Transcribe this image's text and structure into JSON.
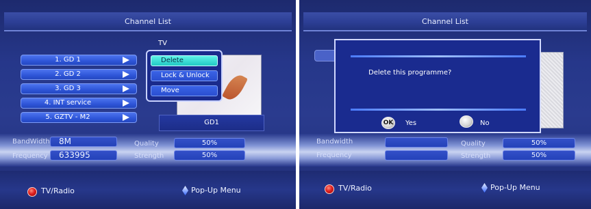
{
  "left": {
    "title": "Channel List",
    "tv_label": "TV",
    "channels": [
      {
        "label": "1. GD 1"
      },
      {
        "label": "2. GD 2"
      },
      {
        "label": "3. GD 3"
      },
      {
        "label": "4. INT service"
      },
      {
        "label": "5. GZTV - M2"
      }
    ],
    "popup": {
      "items": [
        {
          "label": "Delete",
          "selected": true
        },
        {
          "label": "Lock & Unlock",
          "selected": false
        },
        {
          "label": "Move",
          "selected": false
        }
      ]
    },
    "preview_caption": "GD1",
    "info": {
      "bandwidth_label": "BandWidth",
      "bandwidth_value": "8M",
      "frequency_label": "Frequency",
      "frequency_value": "633995",
      "quality_label": "Quality",
      "quality_value": "50%",
      "strength_label": "Strength",
      "strength_value": "50%"
    },
    "footer": {
      "tv_radio": "TV/Radio",
      "popup_menu": "Pop-Up Menu"
    }
  },
  "right": {
    "title": "Channel List",
    "dialog": {
      "message": "Delete this programme?",
      "ok_badge": "OK",
      "yes": "Yes",
      "no": "No"
    },
    "info": {
      "bandwidth_label": "Bandwidth",
      "frequency_label": "Frequency",
      "quality_label": "Quality",
      "quality_value": "50%",
      "strength_label": "Strength",
      "strength_value": "50%"
    },
    "footer": {
      "tv_radio": "TV/Radio",
      "popup_menu": "Pop-Up Menu"
    }
  },
  "colors": {
    "background": "#26378a",
    "popup_selected": "#22c8c4",
    "field_blue": "#2442b9",
    "red_button": "#e01f1f"
  },
  "icons": {
    "channel_arrow": "play-triangle-icon",
    "tv_radio": "red-circle-icon",
    "popup_menu": "blue-diamond-icon"
  }
}
